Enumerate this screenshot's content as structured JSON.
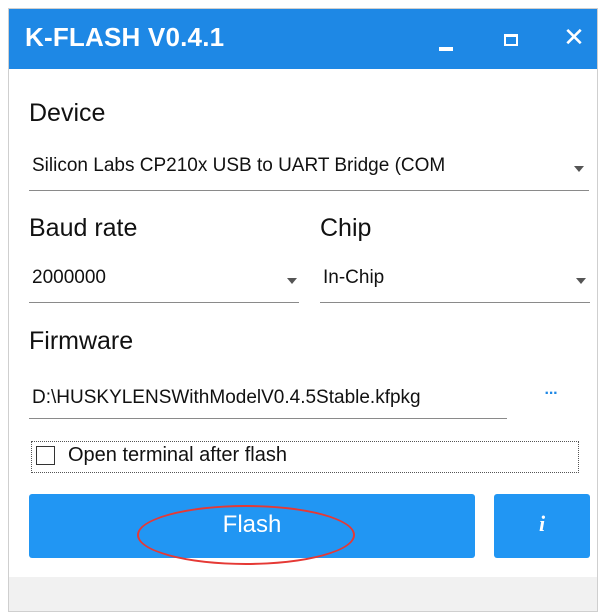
{
  "window": {
    "title": "K-FLASH V0.4.1",
    "accent_color": "#1e88e5",
    "controls": {
      "minimize_icon": "minimize-icon",
      "maximize_icon": "maximize-icon",
      "close_glyph": "✕"
    }
  },
  "device": {
    "label": "Device",
    "selected": "Silicon Labs CP210x USB to UART Bridge (COM",
    "icon": "chevron-down-icon"
  },
  "baud_rate": {
    "label": "Baud rate",
    "selected": "2000000",
    "icon": "chevron-down-icon"
  },
  "chip": {
    "label": "Chip",
    "selected": "In-Chip",
    "icon": "chevron-down-icon"
  },
  "firmware": {
    "label": "Firmware",
    "path": "D:\\HUSKYLENSWithModelV0.4.5Stable.kfpkg",
    "browse_label": "···"
  },
  "options": {
    "open_terminal_label": "Open terminal after flash",
    "open_terminal_checked": false
  },
  "actions": {
    "flash_label": "Flash",
    "info_label": "i",
    "button_color": "#2196f3",
    "highlight_color": "#e53935"
  }
}
